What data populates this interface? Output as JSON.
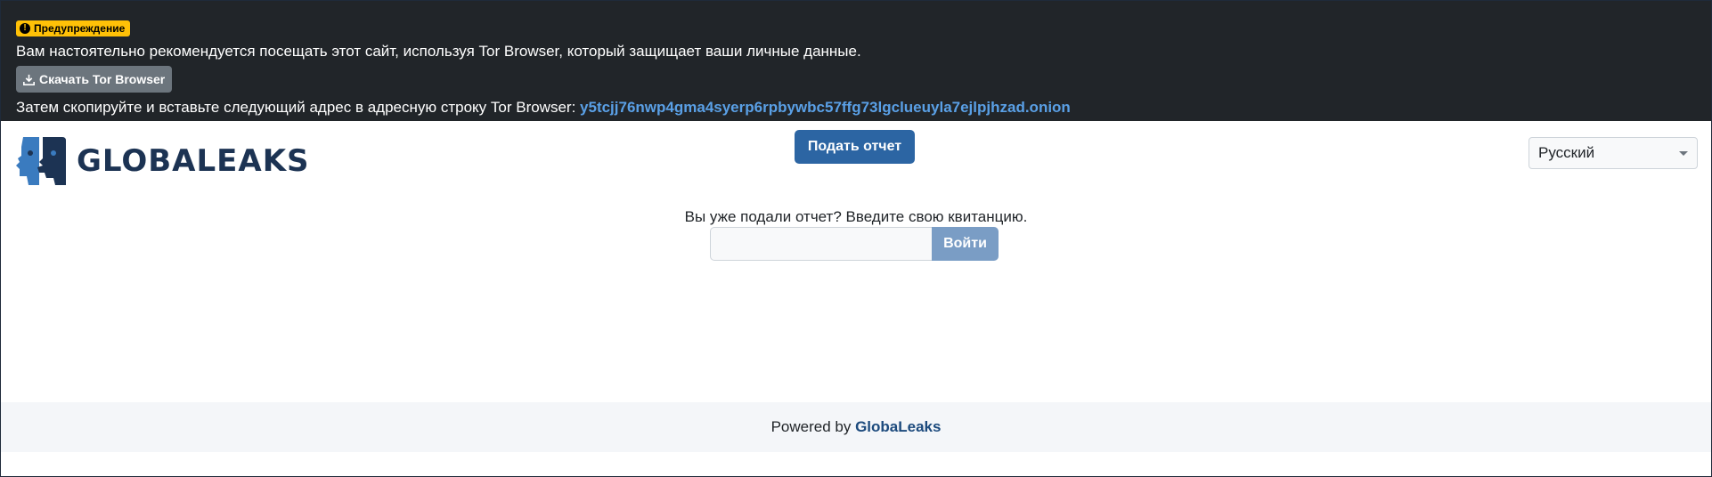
{
  "banner": {
    "badge_label": "Предупреждение",
    "message": "Вам настоятельно рекомендуется посещать этот сайт, используя Tor Browser, который защищает ваши личные данные.",
    "download_label": "Скачать Tor Browser",
    "onion_prefix": "Затем скопируйте и вставьте следующий адрес в адресную строку Tor Browser: ",
    "onion_address": "y5tcjj76nwp4gma4syerp6rpbywbc57ffg73lgclueuyla7ejlpjhzad.onion"
  },
  "header": {
    "logo_text": "GLOBALEAKS",
    "language": "Русский"
  },
  "main": {
    "submit_label": "Подать отчет",
    "receipt_prompt": "Вы уже подали отчет? Введите свою квитанцию.",
    "receipt_value": "",
    "login_label": "Войти"
  },
  "footer": {
    "powered_by": "Powered by ",
    "brand_link": "GlobaLeaks"
  },
  "colors": {
    "banner_bg": "#212529",
    "badge": "#ffc107",
    "primary": "#2c65a3",
    "brand": "#1c3353",
    "link": "#5aa0e6"
  },
  "icons": {
    "badge_icon": "exclamation-circle-icon",
    "download_icon": "download-icon",
    "logo_icon": "globaleaks-faces-logo-icon",
    "select_icon": "caret-down-icon"
  }
}
